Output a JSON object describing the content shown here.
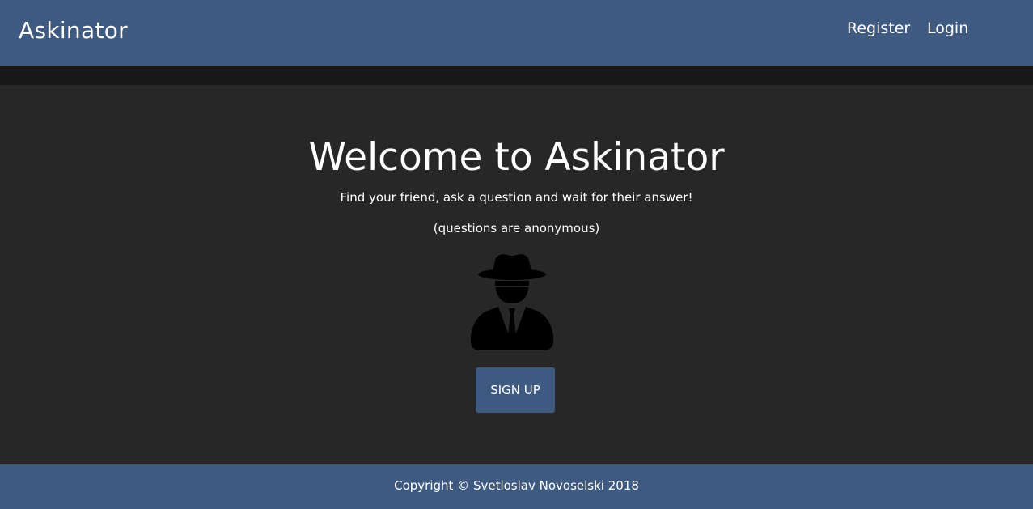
{
  "header": {
    "brand": "Askinator",
    "nav": {
      "register": "Register",
      "login": "Login"
    }
  },
  "hero": {
    "title": "Welcome to Askinator",
    "tagline": "Find your friend, ask a question and wait for their answer!",
    "note": "(questions are anonymous)",
    "icon": "spy-icon",
    "signup_label": "SIGN UP"
  },
  "footer": {
    "copyright": "Copyright © Svetloslav Novoselski 2018"
  },
  "colors": {
    "primary": "#3f5a80",
    "background": "#272727",
    "strip": "#181818",
    "text": "#ffffff"
  }
}
